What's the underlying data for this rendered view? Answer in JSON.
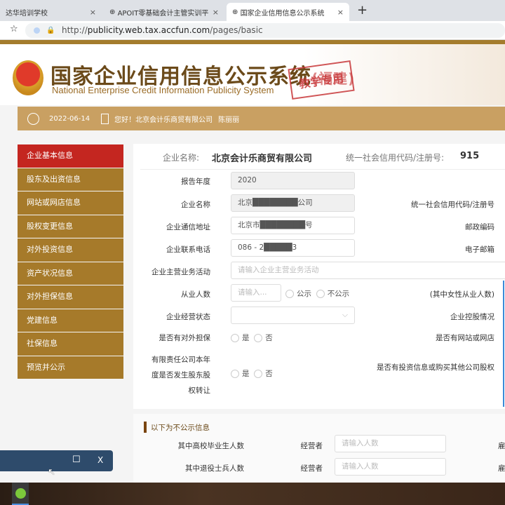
{
  "browser": {
    "tabs": [
      {
        "label": "达华培训学校",
        "active": false
      },
      {
        "label": "APOIT零基础会计主管实训平台",
        "active": false
      },
      {
        "label": "国家企业信用信息公示系统",
        "active": true
      }
    ],
    "new_tab": "+",
    "close": "×",
    "url_prefix": "http://",
    "url_host": "publicity.web.tax.accfun.com",
    "url_path": "/pages/basic"
  },
  "header": {
    "title": "国家企业信用信息公示系统",
    "title_suffix": "(福建)",
    "subtitle": "National Enterprise Credit Information Publicity System",
    "stamp": "教学专用"
  },
  "infobar": {
    "date": "2022-06-14",
    "greeting": "您好！北京会计乐商贸有限公司",
    "user": "陈丽丽"
  },
  "sidebar": {
    "items": [
      {
        "label": "企业基本信息",
        "active": true
      },
      {
        "label": "股东及出资信息"
      },
      {
        "label": "网站或网店信息"
      },
      {
        "label": "股权变更信息"
      },
      {
        "label": "对外投资信息"
      },
      {
        "label": "资产状况信息"
      },
      {
        "label": "对外担保信息"
      },
      {
        "label": "党建信息"
      },
      {
        "label": "社保信息"
      },
      {
        "label": "预览并公示"
      }
    ]
  },
  "main": {
    "company_label": "企业名称:",
    "company_name": "北京会计乐商贸有限公司",
    "credit_code_label": "统一社会信用代码/注册号:",
    "credit_code": "915",
    "form": {
      "report_year_label": "报告年度",
      "report_year": "2020",
      "name_label": "企业名称",
      "name_value": "北京████████公司",
      "address_label": "企业通信地址",
      "address_value": "北京市████████号",
      "phone_label": "企业联系电话",
      "phone_value": "086 - 2█████3",
      "business_label": "企业主营业务活动",
      "business_placeholder": "请输入企业主营业务活动",
      "employees_label": "从业人数",
      "employees_placeholder": "请输入...",
      "public": "公示",
      "not_public": "不公示",
      "status_label": "企业经营状态",
      "guarantee_label": "是否有对外担保",
      "yes": "是",
      "no": "否",
      "transfer_label": "有限责任公司本年度是否发生股东股权转让",
      "right_credit_code": "统一社会信用代码/注册号",
      "right_postal": "邮政编码",
      "right_email": "电子邮箱",
      "right_female": "(其中女性从业人数)",
      "right_holding": "企业控股情况",
      "right_website": "是否有网站或网店",
      "right_invest": "是否有投资信息或购买其他公司股权"
    }
  },
  "nonpublic": {
    "title": "以下为不公示信息",
    "rows": [
      {
        "label": "其中高校毕业生人数",
        "sub": "经营者",
        "placeholder": "请输入人数",
        "right": "雇"
      },
      {
        "label": "其中退役士兵人数",
        "sub": "经营者",
        "placeholder": "请输入人数",
        "right": "雇"
      }
    ]
  },
  "dialog": {
    "maximize": "☐",
    "close": "X"
  }
}
